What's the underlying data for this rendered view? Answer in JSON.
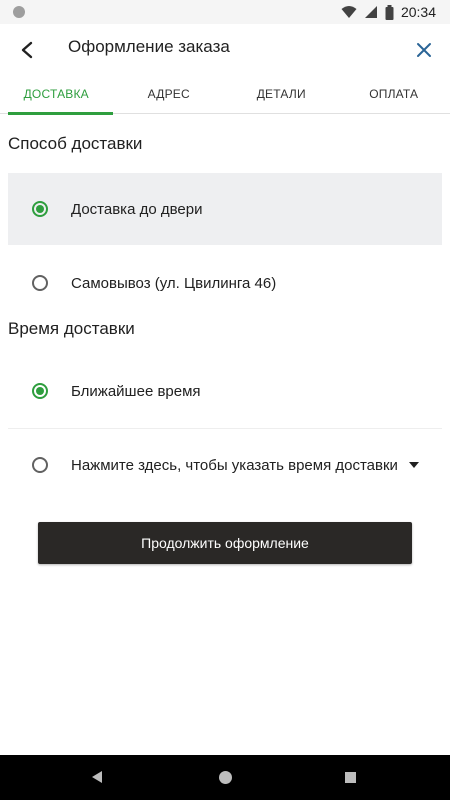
{
  "status_bar": {
    "time": "20:34",
    "icons": [
      "notification-dot-icon",
      "wifi-icon",
      "signal-icon",
      "battery-icon"
    ]
  },
  "app_bar": {
    "title": "Оформление заказа",
    "back_icon": "arrow-back-icon",
    "close_icon": "close-icon"
  },
  "tabs": [
    {
      "label": "ДОСТАВКА",
      "active": true
    },
    {
      "label": "АДРЕС",
      "active": false
    },
    {
      "label": "ДЕТАЛИ",
      "active": false
    },
    {
      "label": "ОПЛАТА",
      "active": false
    }
  ],
  "delivery_method": {
    "title": "Способ доставки",
    "options": [
      {
        "label": "Доставка до двери",
        "selected": true
      },
      {
        "label": "Самовывоз (ул. Цвилинга 46)",
        "selected": false
      }
    ]
  },
  "delivery_time": {
    "title": "Время доставки",
    "options": [
      {
        "label": "Ближайшее время",
        "selected": true
      },
      {
        "label": "Нажмите здесь, чтобы указать время доставки",
        "selected": false
      }
    ]
  },
  "continue_button": {
    "label": "Продолжить оформление"
  },
  "colors": {
    "accent": "#2e9e3e",
    "button_bg": "#2a2826",
    "selected_bg": "#eeeff1",
    "close_icon": "#2a6496"
  }
}
